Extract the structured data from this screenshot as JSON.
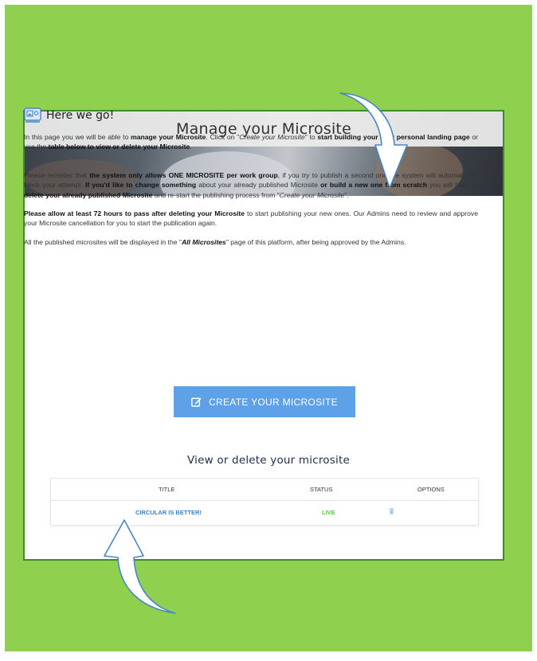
{
  "header": {
    "title": "Manage your Microsite"
  },
  "intro": {
    "heading": "Here we go!",
    "p1": {
      "a": "In this page you we will be able to ",
      "b": "manage your Microsite",
      "c": ". Click on \"",
      "d": "Create your Microsite",
      "e": "\" to ",
      "f": "start building your very personal landing page",
      "g": " or use the ",
      "h": "table below to view or delete your Microsite",
      "i": "."
    },
    "p2": {
      "a": "Please remeber that ",
      "b": "the system only allows ONE MICROSITE per work group",
      "c": ", if you try to publish a second one the system will automatically block your attempt. ",
      "d": "If you'd like to change something",
      "e": " about your already published Microsite ",
      "f": "or build a new one from scratch",
      "g": " you will have to ",
      "h": "delete your already published Microsite",
      "i": " and re-start the publishing process from \"",
      "j": "Create your Microsite",
      "k": "\"."
    },
    "p3": {
      "a": "Please allow at least 72 hours to pass after deleting your Microsite",
      "b": " to start publishing your new ones. Our Admins need to review and approve your Microsite cancellation for you to start the publication again."
    },
    "p4": {
      "a": "All the published microsites will be displayed in the \"",
      "b": "All Microsites",
      "c": "\" page of this platform, after being approved by the Admins."
    }
  },
  "actions": {
    "create_label": "CREATE YOUR MICROSITE"
  },
  "table": {
    "heading": "View or delete your microsite",
    "columns": {
      "title": "TITLE",
      "status": "STATUS",
      "options": "OPTIONS"
    },
    "rows": [
      {
        "title": "CIRCULAR IS BETTER!",
        "status": "LIVE",
        "option_icon": "trash-icon"
      }
    ]
  },
  "colors": {
    "background": "#8fd04f",
    "button": "#5ea1e8",
    "link": "#3b82c4",
    "status_live": "#5cc447",
    "arrow_fill": "#ffffff",
    "arrow_stroke": "#4a86c5"
  }
}
